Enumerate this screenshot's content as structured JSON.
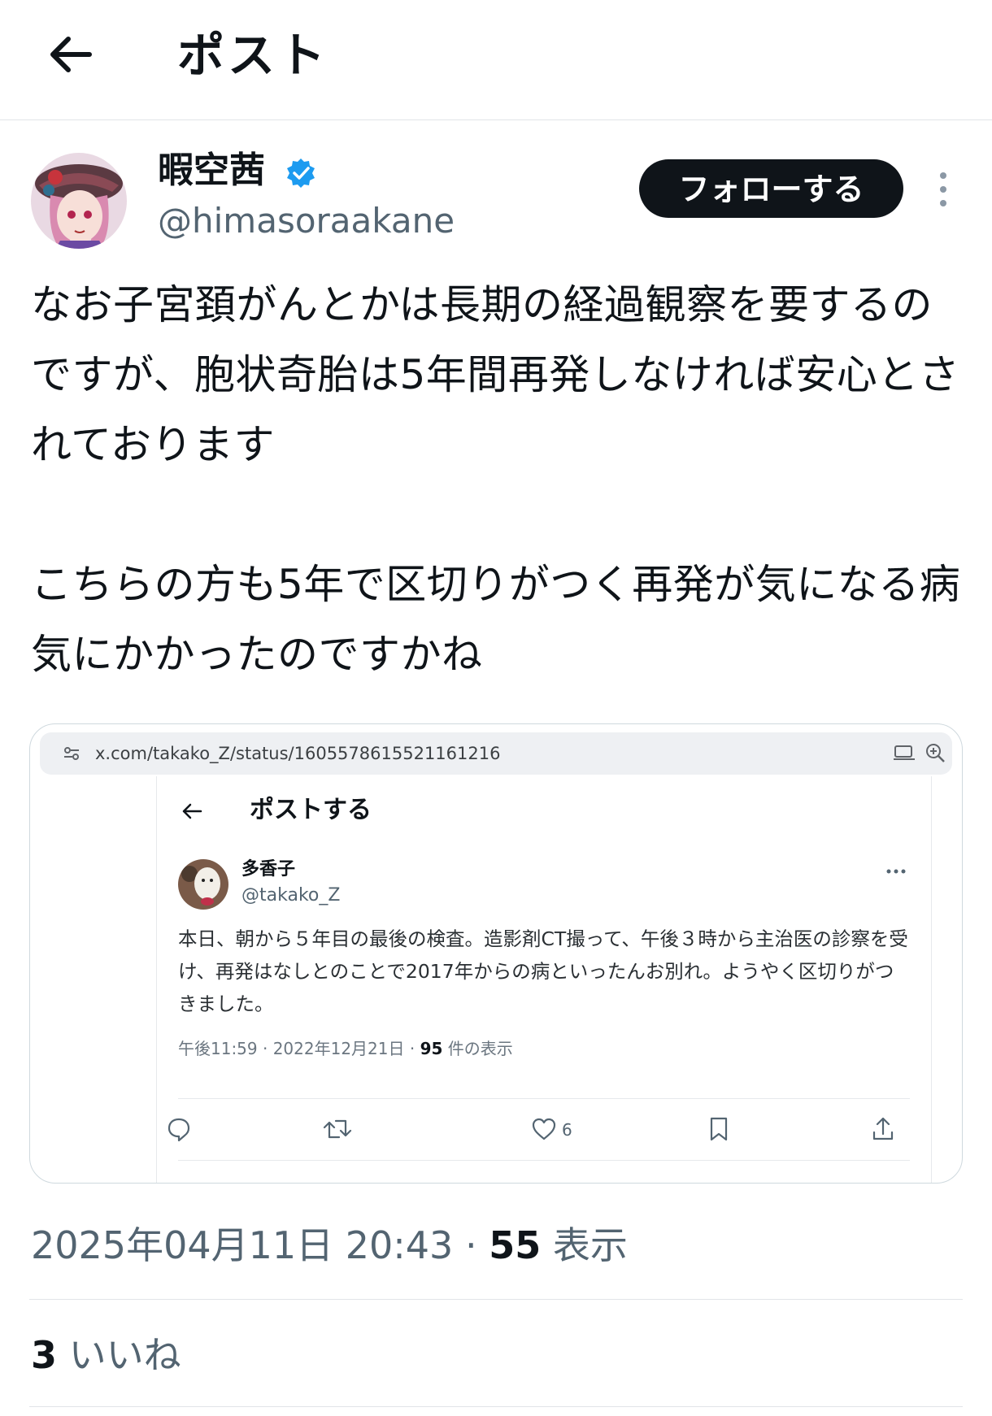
{
  "header": {
    "title": "ポスト"
  },
  "author": {
    "name": "暇空茜",
    "handle": "@himasoraakane",
    "follow_label": "フォローする"
  },
  "tweet": {
    "text": "なお子宮頚がんとかは長期の経過観察を要するのですが、胞状奇胎は5年間再発しなければ安心とされております\n\nこちらの方も5年で区切りがつく再発が気になる病気にかかったのですかね"
  },
  "quote": {
    "url": "x.com/takako_Z/status/1605578615521161216",
    "page_title": "ポストする",
    "author_name": "多香子",
    "author_handle": "@takako_Z",
    "text": "本日、朝から５年目の最後の検査。造影剤CT撮って、午後３時から主治医の診察を受け、再発はなしとのことで2017年からの病といったんお別れ。ようやく区切りがつきました。",
    "time": "午後11:59 · 2022年12月21日 · ",
    "views_count": "95",
    "views_label": " 件の表示",
    "likes": "6"
  },
  "meta": {
    "timestamp": "2025年04月11日 20:43 · ",
    "views_count": "55",
    "views_label": " 表示"
  },
  "stats": {
    "likes_count": "3",
    "likes_label": " いいね"
  },
  "colors": {
    "accent": "#1d9bf0",
    "text": "#0f1419",
    "muted": "#536471"
  }
}
